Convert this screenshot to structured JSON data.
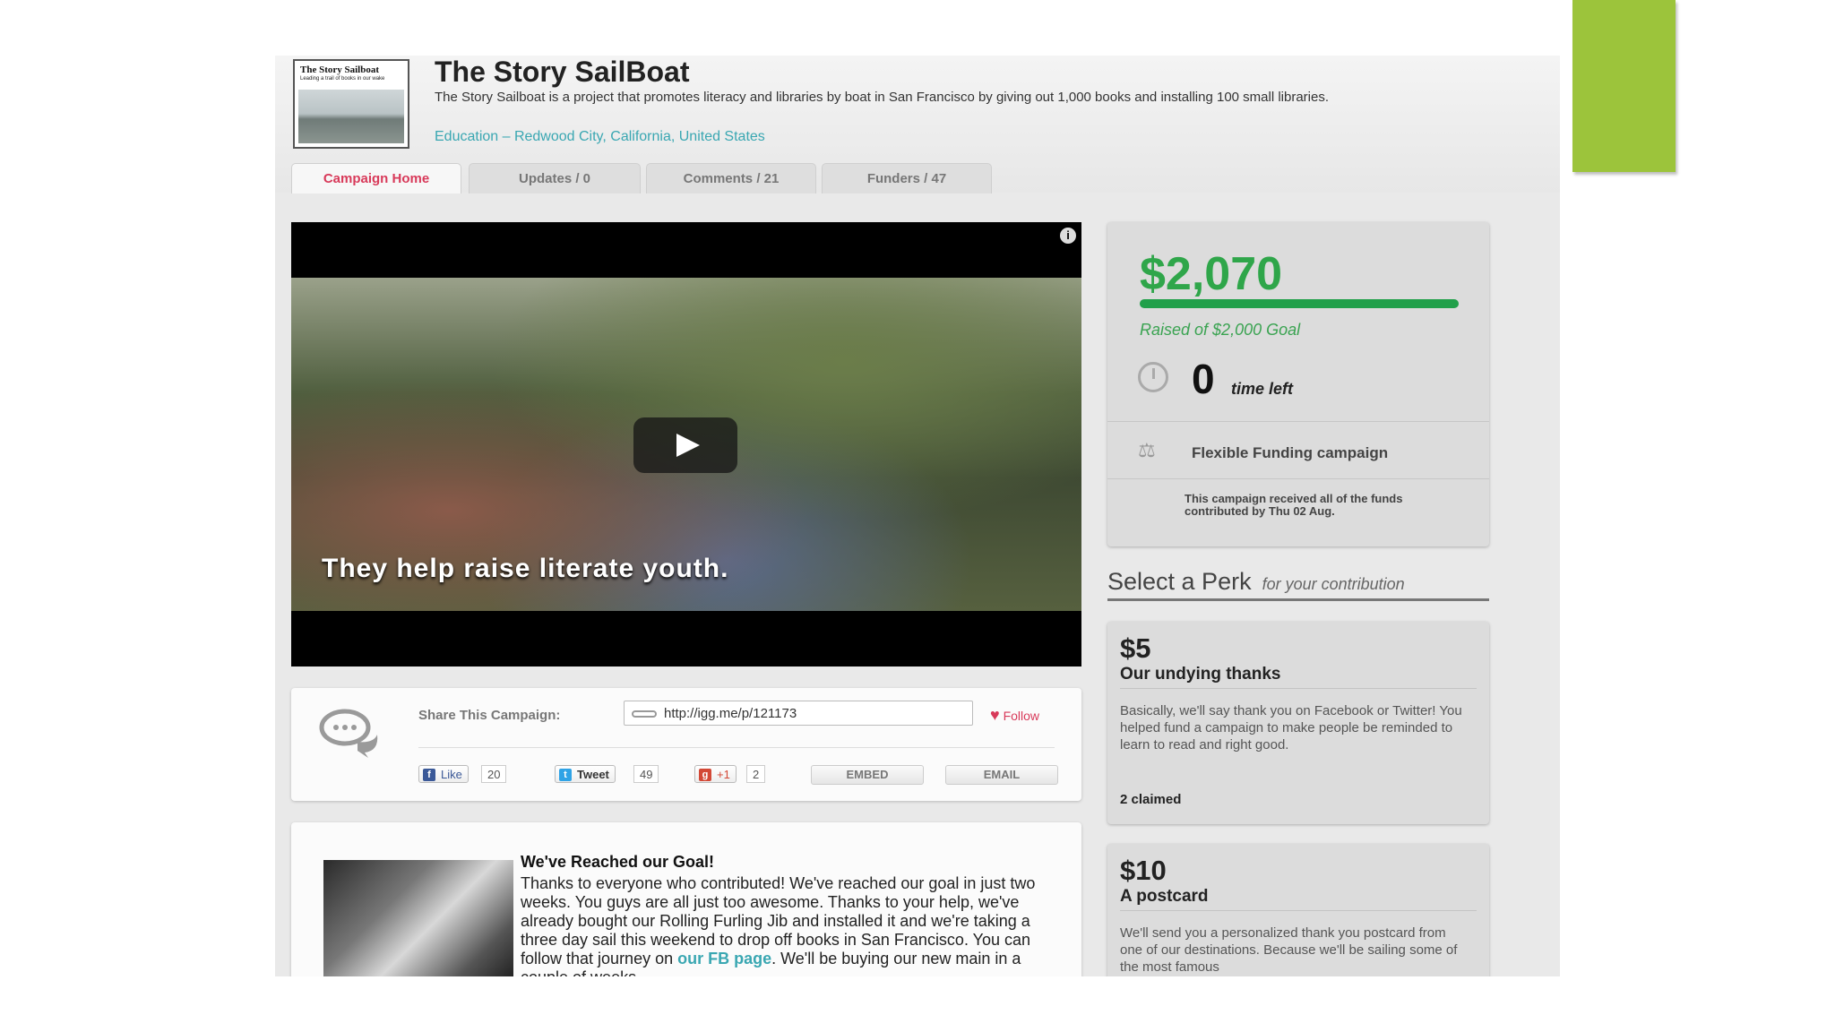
{
  "campaign": {
    "logo": {
      "title": "The Story Sailboat",
      "tagline": "Leading a trail of books in our wake"
    },
    "title": "The Story SailBoat",
    "description": "The Story Sailboat is a project that promotes literacy and libraries by boat in San Francisco by giving out 1,000 books and installing 100 small libraries.",
    "location": "Education – Redwood City, California, United States"
  },
  "tabs": [
    {
      "label": "Campaign Home",
      "active": true
    },
    {
      "label": "Updates / 0"
    },
    {
      "label": "Comments / 21"
    },
    {
      "label": "Funders / 47"
    }
  ],
  "video": {
    "caption": "They help raise literate youth."
  },
  "share": {
    "label": "Share This Campaign:",
    "url": "http://igg.me/p/121173",
    "follow": "Follow",
    "like": {
      "label": "Like",
      "count": "20"
    },
    "tweet": {
      "label": "Tweet",
      "count": "49"
    },
    "plusone": {
      "label": "+1",
      "count": "2"
    },
    "embed": "EMBED",
    "email": "EMAIL"
  },
  "update": {
    "title": "We've Reached our Goal!",
    "body": "Thanks to everyone who contributed! We've reached our goal in just two weeks. You guys are all just too awesome. Thanks to your help, we've already bought our Rolling Furling Jib and installed it and we're taking a three day sail this weekend to drop off books in San Francisco. You can follow that journey on ",
    "link": "our FB page",
    "tail": ". We'll be buying our new main in a couple of weeks."
  },
  "funding": {
    "amount": "$2,070",
    "raised_of": "Raised of $2,000 Goal",
    "progress_percent": 100,
    "time_num": "0",
    "time_label": "time left",
    "flexible": "Flexible Funding campaign",
    "note": "This campaign received all of the funds contributed by Thu 02 Aug."
  },
  "perks_heading": {
    "big": "Select a Perk",
    "small": "for your contribution"
  },
  "perks": [
    {
      "price": "$5",
      "name": "Our undying thanks",
      "description": "Basically, we'll say thank you on Facebook or Twitter! You helped fund a campaign to make people be reminded to learn to read and right good.",
      "claimed": "2 claimed"
    },
    {
      "price": "$10",
      "name": "A postcard",
      "description": "We'll send you a personalized thank you postcard from one of our destinations. Because we'll be sailing some of the most famous"
    }
  ],
  "colors": {
    "accent_bar": "#9cc43b",
    "funding_green": "#2fa64a",
    "active_tab": "#d83a5a",
    "link": "#3aa7b2"
  }
}
